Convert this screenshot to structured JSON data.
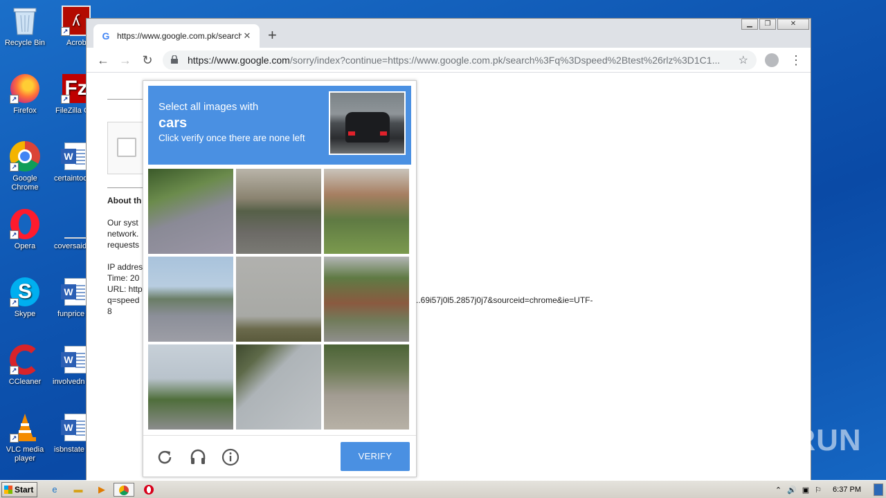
{
  "desktop": {
    "icons": [
      {
        "label": "Recycle Bin"
      },
      {
        "label": "Acrobat Reader"
      },
      {
        "label": "Firefox"
      },
      {
        "label": "FileZilla C"
      },
      {
        "label": "Google Chrome"
      },
      {
        "label": "certaintoo"
      },
      {
        "label": "Opera"
      },
      {
        "label": "coversaid"
      },
      {
        "label": "Skype"
      },
      {
        "label": "funprice"
      },
      {
        "label": "CCleaner"
      },
      {
        "label": "involvedn"
      },
      {
        "label": "VLC media player"
      },
      {
        "label": "isbnstate"
      }
    ]
  },
  "browser": {
    "tab_title": "https://www.google.com.pk/search?",
    "tab_close": "✕",
    "new_tab": "+",
    "url_host": "https://www.google.com",
    "url_path": "/sorry/index?continue=https://www.google.com.pk/search%3Fq%3Dspeed%2Btest%26rlz%3D1C1...",
    "window_controls": {
      "minimize": "▁",
      "restore": "❐",
      "close": "✕"
    }
  },
  "page": {
    "about_heading": "About th",
    "para1": [
      "Our syst",
      "network.",
      "requests"
    ],
    "para2": [
      "IP addres",
      "Time: 20",
      "URL: http",
      "q=speed",
      "8"
    ],
    "url_tail": "..69i57j0l5.2857j0j7&sourceid=chrome&ie=UTF-"
  },
  "captcha": {
    "instruction_line1": "Select all images with",
    "target_object": "cars",
    "instruction_line3": "Click verify once there are none left",
    "verify_label": "VERIFY",
    "tile_count": 9
  },
  "watermark": "ANY RUN",
  "taskbar": {
    "start_label": "Start",
    "clock": "6:37 PM"
  },
  "colors": {
    "captcha_blue": "#4a90e2",
    "desktop_blue": "#0f57b3"
  }
}
